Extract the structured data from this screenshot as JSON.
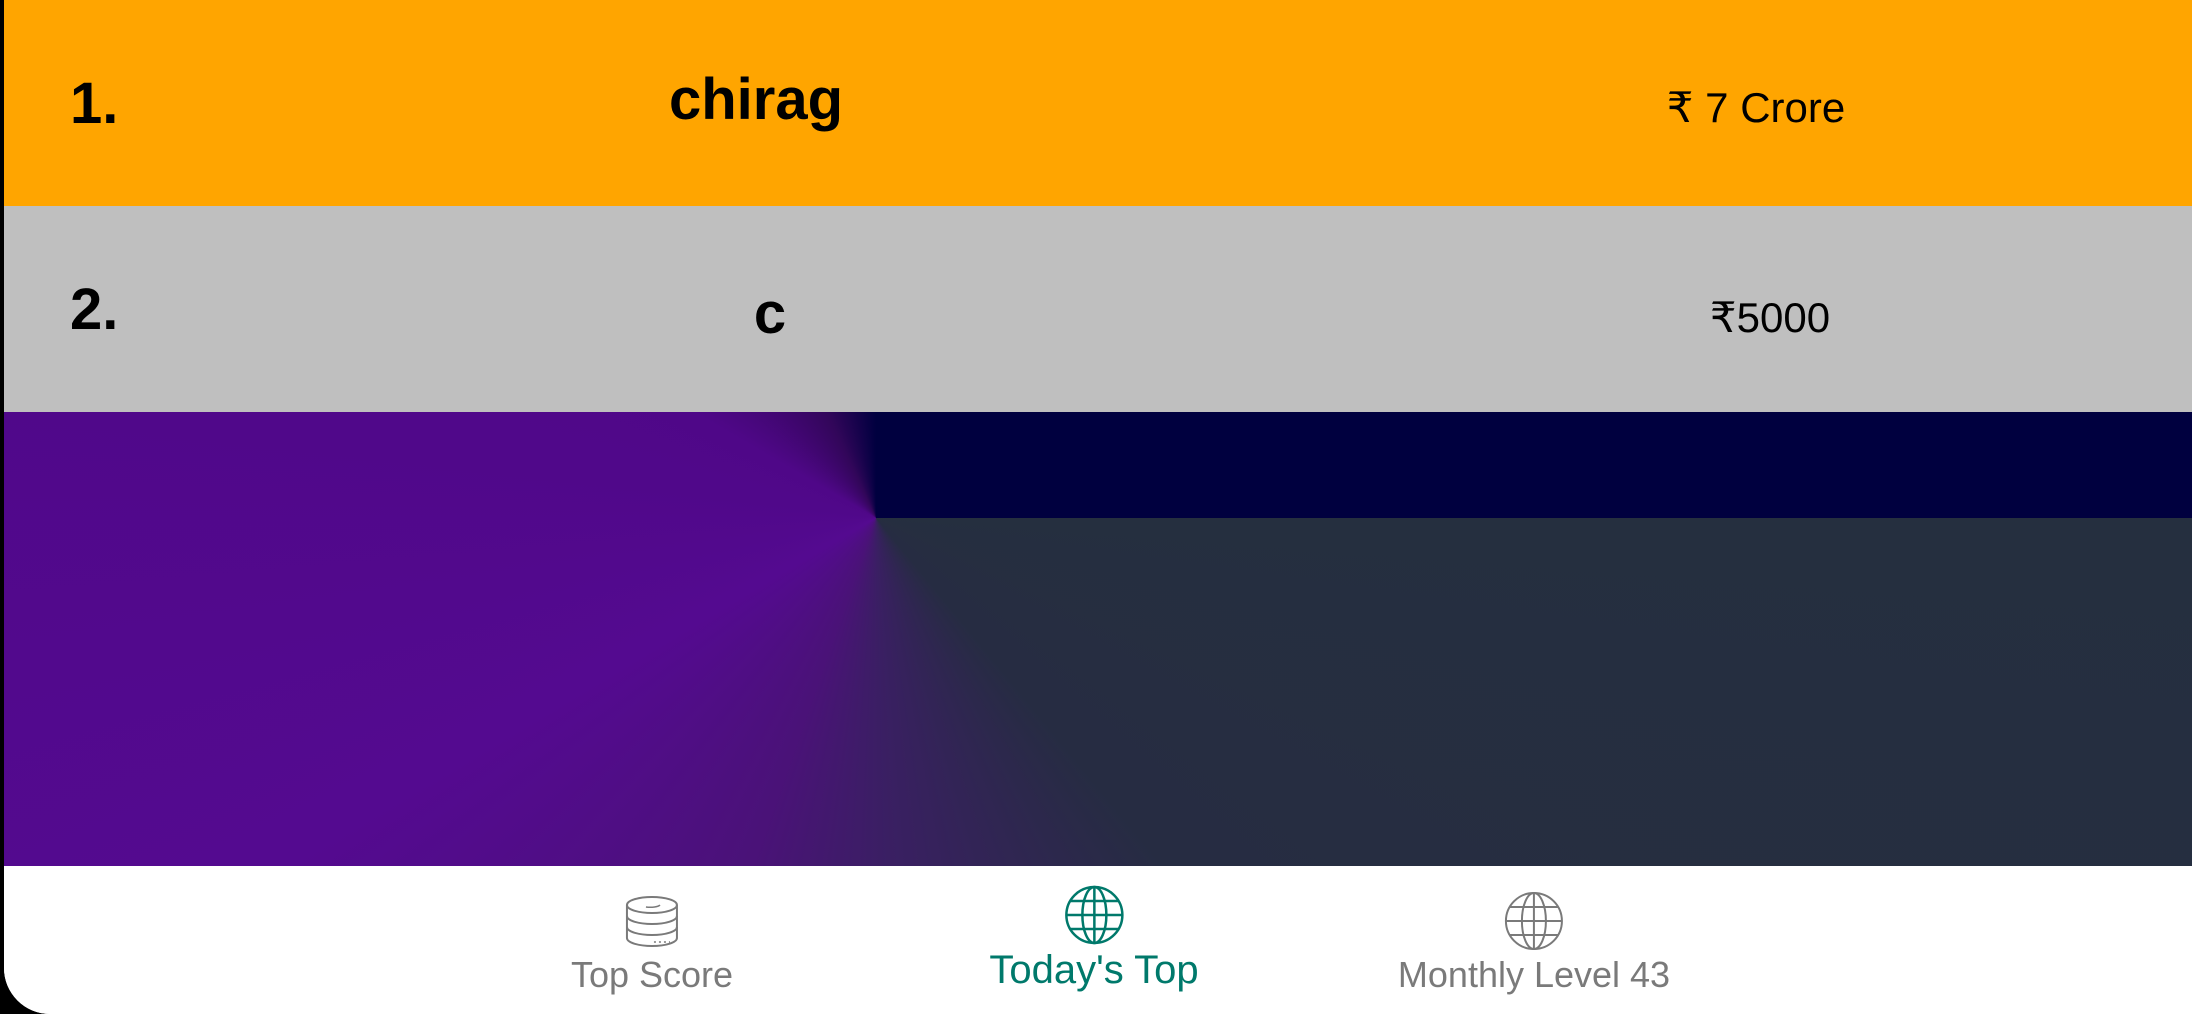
{
  "leaderboard": {
    "rows": [
      {
        "rank": "1.",
        "name": "chirag",
        "prize": "₹ 7 Crore",
        "background": "#FFA500"
      },
      {
        "rank": "2.",
        "name": "c",
        "prize": "₹5000",
        "background": "#BFBFBF"
      }
    ]
  },
  "bottom_nav": {
    "items": [
      {
        "label": "Top Score",
        "icon": "coin-stack-icon",
        "active": false
      },
      {
        "label": "Today's Top",
        "icon": "globe-icon",
        "active": true
      },
      {
        "label": "Monthly Level 43",
        "icon": "globe-icon",
        "active": false
      }
    ],
    "active_color": "#00796B",
    "inactive_color": "#7A7A7A"
  },
  "colors": {
    "gold": "#FFA500",
    "silver": "#BFBFBF",
    "banner_purple": "#540A90",
    "banner_navy": "#00003F",
    "banner_slate": "#252F3F"
  }
}
